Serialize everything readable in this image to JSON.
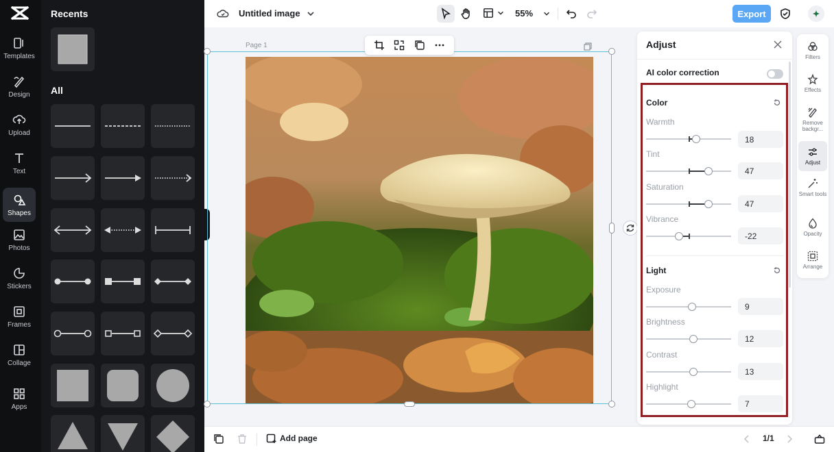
{
  "rail": {
    "items": [
      {
        "label": "Templates",
        "icon": "templates-icon"
      },
      {
        "label": "Design",
        "icon": "design-icon"
      },
      {
        "label": "Upload",
        "icon": "upload-icon"
      },
      {
        "label": "Text",
        "icon": "text-icon"
      },
      {
        "label": "Shapes",
        "icon": "shapes-icon"
      },
      {
        "label": "Photos",
        "icon": "photos-icon"
      },
      {
        "label": "Stickers",
        "icon": "stickers-icon"
      },
      {
        "label": "Frames",
        "icon": "frames-icon"
      },
      {
        "label": "Collage",
        "icon": "collage-icon"
      },
      {
        "label": "Apps",
        "icon": "apps-icon"
      }
    ],
    "active": "Shapes"
  },
  "panel": {
    "recents_title": "Recents",
    "all_title": "All"
  },
  "topbar": {
    "doc_title": "Untitled image",
    "zoom": "55%",
    "export_label": "Export"
  },
  "canvas": {
    "page_label": "Page 1"
  },
  "bottombar": {
    "add_page_label": "Add page",
    "page_counter": "1/1"
  },
  "adjust": {
    "title": "Adjust",
    "ai_label": "AI color correction",
    "ai_enabled": false,
    "color_section": "Color",
    "light_section": "Light",
    "color": {
      "warmth": {
        "label": "Warmth",
        "value": "18"
      },
      "tint": {
        "label": "Tint",
        "value": "47"
      },
      "saturation": {
        "label": "Saturation",
        "value": "47"
      },
      "vibrance": {
        "label": "Vibrance",
        "value": "-22"
      }
    },
    "light": {
      "exposure": {
        "label": "Exposure",
        "value": "9"
      },
      "brightness": {
        "label": "Brightness",
        "value": "12"
      },
      "contrast": {
        "label": "Contrast",
        "value": "13"
      },
      "highlight": {
        "label": "Highlight",
        "value": "7"
      }
    }
  },
  "tools": {
    "filters": "Filters",
    "effects": "Effects",
    "remove_bg": "Remove backgr...",
    "adjust": "Adjust",
    "smart_tools": "Smart tools",
    "opacity": "Opacity",
    "arrange": "Arrange"
  },
  "colors": {
    "accent": "#5aa8f5",
    "highlight_box": "#8f1d22",
    "selection": "#5bc0d6"
  }
}
